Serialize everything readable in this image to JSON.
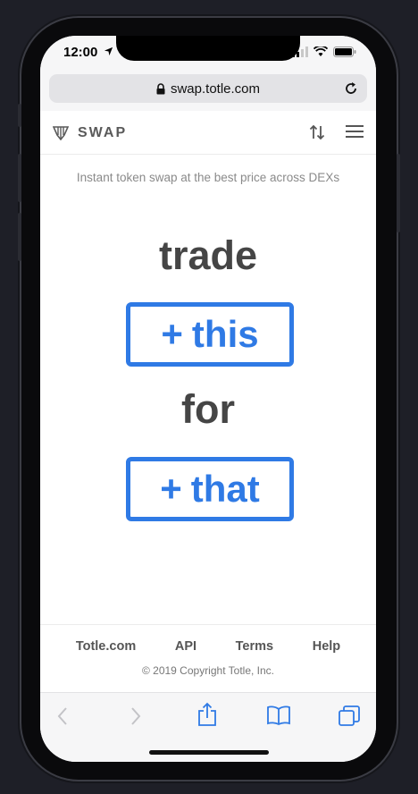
{
  "status": {
    "time": "12:00"
  },
  "browser": {
    "url": "swap.totle.com"
  },
  "header": {
    "logo_text": "SWAP"
  },
  "main": {
    "tagline": "Instant token swap at the best price across DEXs",
    "trade_word": "trade",
    "for_word": "for",
    "this_button_label": "this",
    "that_button_label": "that",
    "plus_glyph": "+"
  },
  "footer": {
    "links": [
      "Totle.com",
      "API",
      "Terms",
      "Help"
    ],
    "copyright": "© 2019 Copyright Totle, Inc."
  },
  "colors": {
    "accent": "#2f7ae5",
    "text_dark": "#454545",
    "frame": "#0a0a0c",
    "background": "#1e1f27"
  },
  "icons": {
    "status": [
      "location-arrow-icon",
      "signal-bars-icon",
      "wifi-icon",
      "battery-icon"
    ],
    "browser": [
      "lock-icon",
      "reload-icon"
    ],
    "header": [
      "totle-logo-icon",
      "swap-arrows-icon",
      "hamburger-menu-icon"
    ],
    "toolbar": [
      "back-chevron-icon",
      "forward-chevron-icon",
      "share-icon",
      "bookmarks-icon",
      "tabs-icon"
    ]
  }
}
